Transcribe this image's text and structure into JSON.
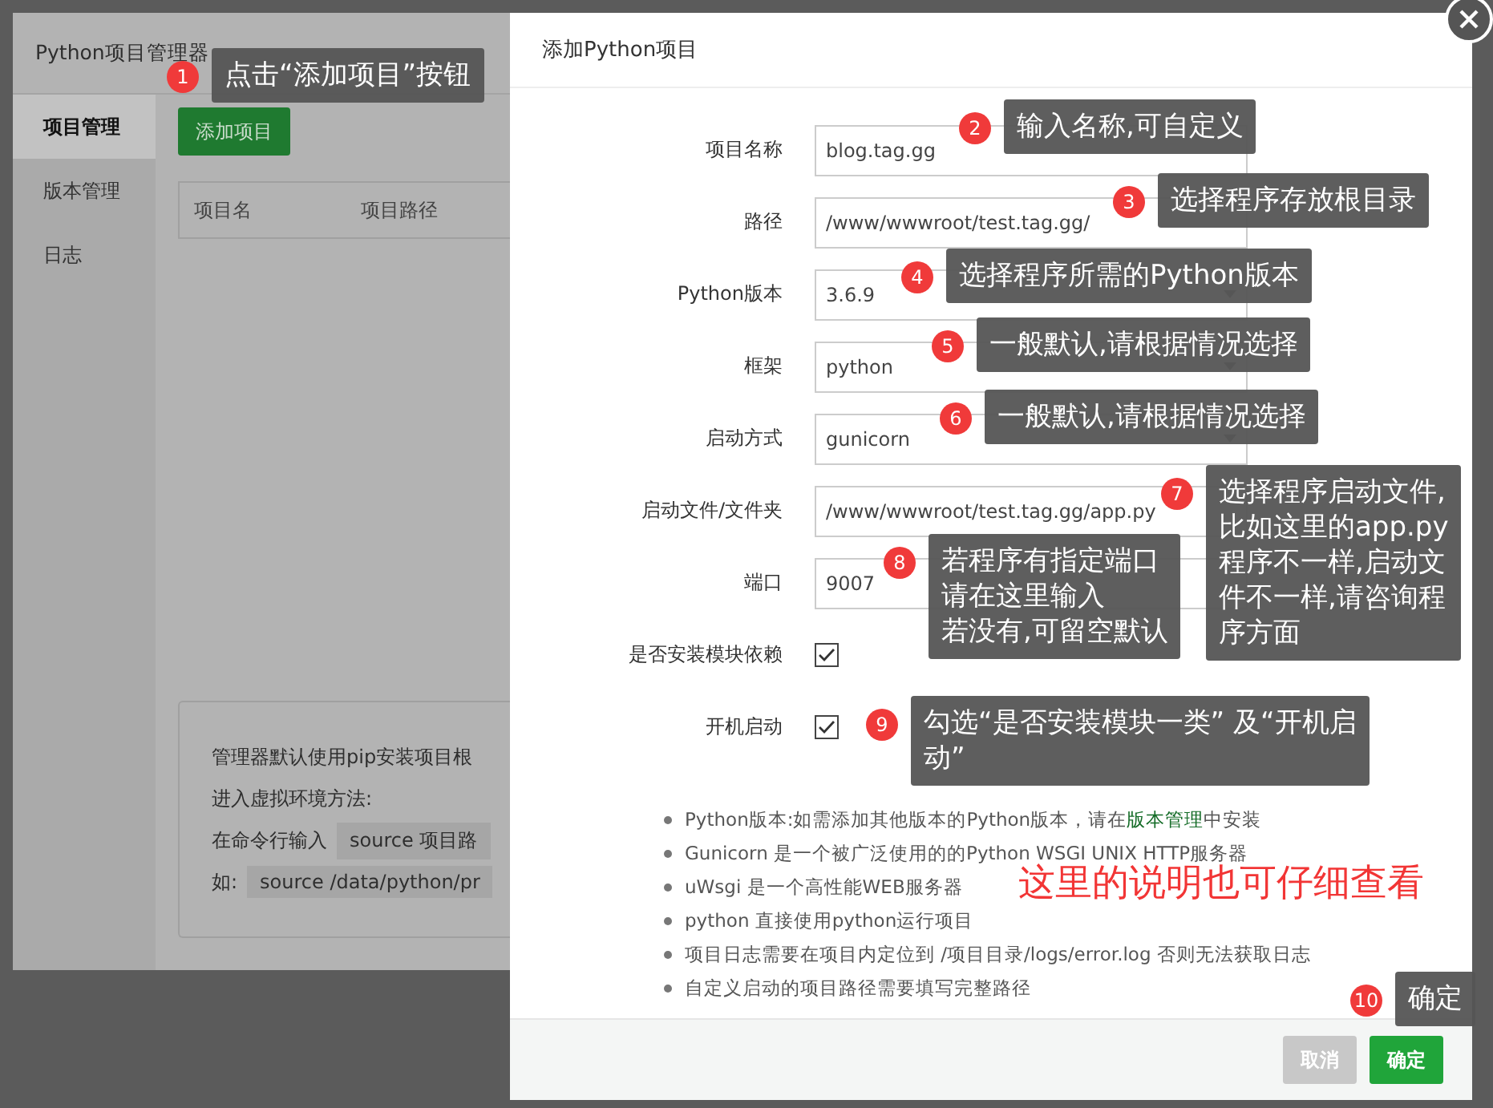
{
  "manager": {
    "title": "Python项目管理器",
    "sidebar": [
      {
        "label": "项目管理",
        "selected": true
      },
      {
        "label": "版本管理",
        "selected": false
      },
      {
        "label": "日志",
        "selected": false
      }
    ],
    "add_button": "添加项目",
    "table": {
      "columns": [
        "项目名",
        "项目路径"
      ]
    },
    "info": [
      {
        "text": "管理器默认使用pip安装项目根"
      },
      {
        "text": "进入虚拟环境方法:"
      },
      {
        "text": "在命令行输入",
        "code": "source 项目路"
      },
      {
        "text": "如:",
        "code": "source /data/python/pr"
      }
    ]
  },
  "dialog": {
    "title": "添加Python项目",
    "fields": [
      {
        "label": "项目名称",
        "kind": "input",
        "value": "blog.tag.gg"
      },
      {
        "label": "路径",
        "kind": "input",
        "value": "/www/wwwroot/test.tag.gg/"
      },
      {
        "label": "Python版本",
        "kind": "select",
        "value": "3.6.9"
      },
      {
        "label": "框架",
        "kind": "select",
        "value": "python"
      },
      {
        "label": "启动方式",
        "kind": "select",
        "value": "gunicorn"
      },
      {
        "label": "启动文件/文件夹",
        "kind": "input",
        "value": "/www/wwwroot/test.tag.gg/app.py"
      },
      {
        "label": "端口",
        "kind": "input",
        "value": "9007"
      },
      {
        "label": "是否安装模块依赖",
        "kind": "checkbox",
        "checked": true
      },
      {
        "label": "开机启动",
        "kind": "checkbox",
        "checked": true
      }
    ],
    "notes": [
      {
        "text": "Python版本:如需添加其他版本的Python版本，请在",
        "link": "版本管理",
        "after": "中安装"
      },
      {
        "text": "Gunicorn 是一个被广泛使用的的Python WSGI UNIX HTTP服务器"
      },
      {
        "text": "uWsgi 是一个高性能WEB服务器"
      },
      {
        "text": "python 直接使用python运行项目"
      },
      {
        "text": "项目日志需要在项目内定位到 /项目目录/logs/error.log 否则无法获取日志"
      },
      {
        "text": "自定义启动的项目路径需要填写完整路径"
      }
    ],
    "buttons": [
      {
        "label": "取消",
        "kind": "cancel"
      },
      {
        "label": "确定",
        "kind": "primary"
      }
    ]
  },
  "callouts": [
    {
      "number": "1",
      "lines": [
        "点击“添加项目”按钮"
      ]
    },
    {
      "number": "2",
      "lines": [
        "输入名称,可自定义"
      ]
    },
    {
      "number": "3",
      "lines": [
        "选择程序存放根目录"
      ]
    },
    {
      "number": "4",
      "lines": [
        "选择程序所需的Python版本"
      ]
    },
    {
      "number": "5",
      "lines": [
        "一般默认,请根据情况选择"
      ]
    },
    {
      "number": "6",
      "lines": [
        "一般默认,请根据情况选择"
      ]
    },
    {
      "number": "8",
      "lines": [
        "若程序有指定端口",
        "请在这里输入",
        "若没有,可留空默认"
      ]
    },
    {
      "number": "7",
      "lines": [
        "选择程序启动文件,",
        "比如这里的app.py",
        "程序不一样,启动文",
        "件不一样,请咨询程",
        "序方面"
      ]
    },
    {
      "number": "9",
      "lines": [
        "勾选“是否安装模块一类” 及“开机启",
        "动”"
      ]
    },
    {
      "number": "10",
      "lines": [
        "确定"
      ]
    }
  ],
  "remark": "这里的说明也可仔细查看"
}
